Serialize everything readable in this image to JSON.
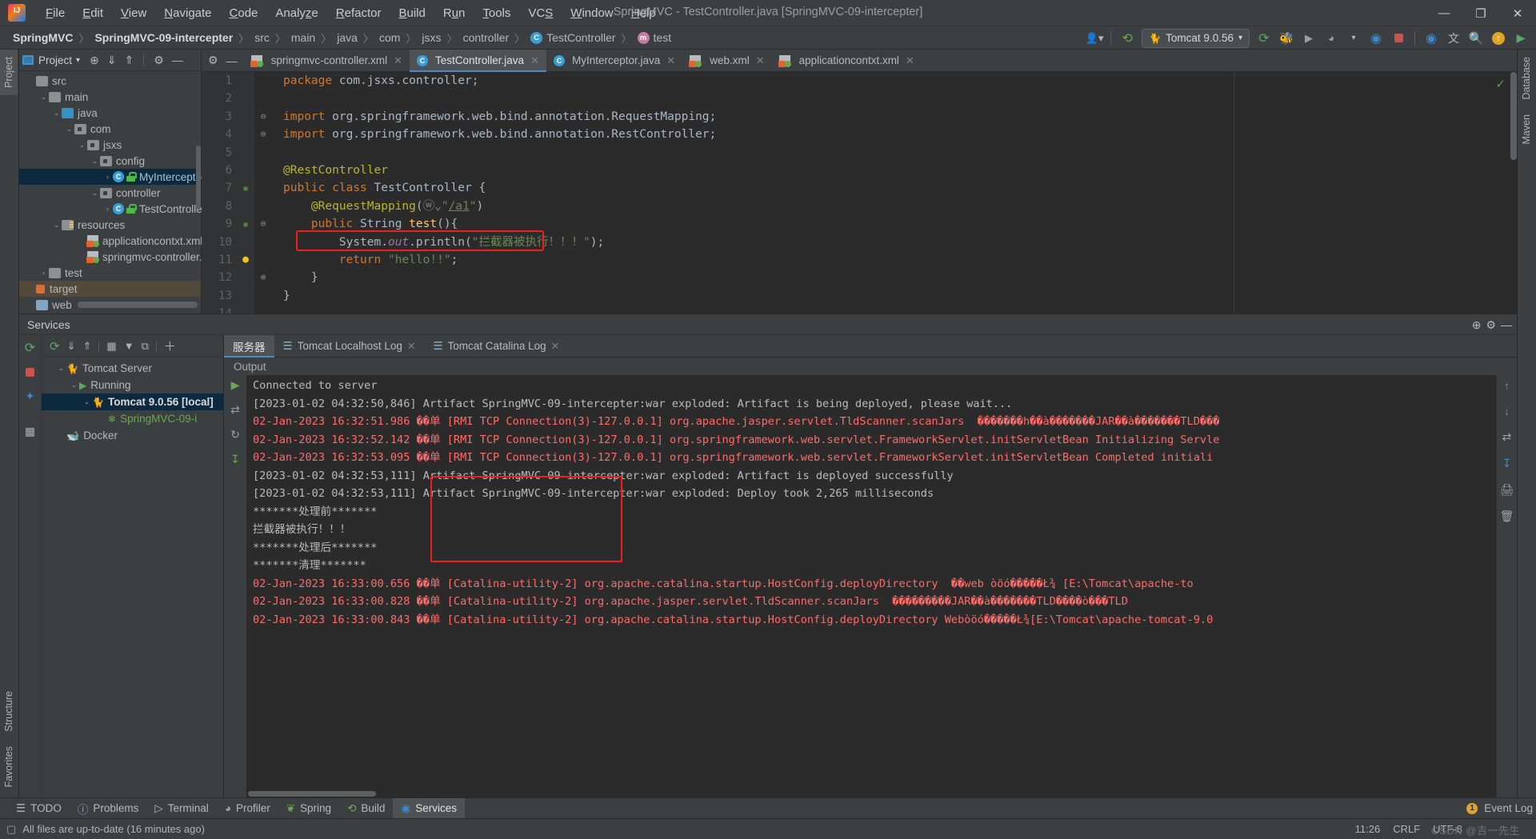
{
  "window": {
    "title": "SpringMVC - TestController.java [SpringMVC-09-intercepter]",
    "minimize": "—",
    "maximize": "❐",
    "close": "✕"
  },
  "menu": {
    "items": [
      {
        "label": "File"
      },
      {
        "label": "Edit"
      },
      {
        "label": "View"
      },
      {
        "label": "Navigate"
      },
      {
        "label": "Code"
      },
      {
        "label": "Analyze"
      },
      {
        "label": "Refactor"
      },
      {
        "label": "Build"
      },
      {
        "label": "Run"
      },
      {
        "label": "Tools"
      },
      {
        "label": "VCS"
      },
      {
        "label": "Window"
      },
      {
        "label": "Help"
      }
    ]
  },
  "breadcrumb": {
    "items": [
      {
        "label": "SpringMVC",
        "bold": true
      },
      {
        "label": "SpringMVC-09-intercepter",
        "bold": true
      },
      {
        "label": "src"
      },
      {
        "label": "main"
      },
      {
        "label": "java"
      },
      {
        "label": "com"
      },
      {
        "label": "jsxs"
      },
      {
        "label": "controller"
      },
      {
        "label": "TestController",
        "badge": "C"
      },
      {
        "label": "test",
        "badge": "m"
      }
    ],
    "separator": "〉"
  },
  "toolbar": {
    "run_config": "Tomcat 9.0.56",
    "icons": [
      {
        "name": "profile-dropdown-icon",
        "glyph": "👤"
      },
      {
        "name": "build-hammer-icon",
        "glyph": "🔨"
      },
      {
        "name": "run-icon",
        "glyph": "↻"
      },
      {
        "name": "debug-icon",
        "glyph": "🐞"
      },
      {
        "name": "run-coverage-icon",
        "glyph": "▶"
      },
      {
        "name": "profiler-icon",
        "glyph": "◔"
      },
      {
        "name": "dropdown-icon",
        "glyph": "▾"
      },
      {
        "name": "tomcat-run-icon",
        "glyph": "◎"
      },
      {
        "name": "stop-icon",
        "glyph": "■"
      },
      {
        "name": "tomcat-debug-icon",
        "glyph": "◎"
      },
      {
        "name": "translate-icon",
        "glyph": "文"
      },
      {
        "name": "search-everywhere-icon",
        "glyph": "🔍"
      },
      {
        "name": "update-icon",
        "glyph": "↑"
      },
      {
        "name": "plugin-icon",
        "glyph": "▶"
      }
    ]
  },
  "left_tool_strip": {
    "top": [
      {
        "label": "Project",
        "active": true
      }
    ],
    "bottom": [
      {
        "label": "Structure"
      },
      {
        "label": "Favorites"
      }
    ]
  },
  "right_tool_strip": {
    "top": [
      {
        "label": "Database"
      },
      {
        "label": "Maven"
      }
    ]
  },
  "project_panel": {
    "title": "Project",
    "header_icons": [
      {
        "name": "project-view-icon",
        "glyph": ""
      },
      {
        "name": "dropdown-icon",
        "glyph": "▾"
      },
      {
        "name": "locate-icon",
        "glyph": "⊕"
      },
      {
        "name": "expand-all-icon",
        "glyph": "⤓"
      },
      {
        "name": "collapse-all-icon",
        "glyph": "⤒"
      },
      {
        "name": "settings-gear-icon",
        "glyph": "⚙"
      },
      {
        "name": "hide-icon",
        "glyph": "—"
      }
    ],
    "tree": [
      {
        "label": "src",
        "depth": 0,
        "twist": "",
        "icon": "f-src"
      },
      {
        "label": "main",
        "depth": 1,
        "twist": "⌄",
        "icon": "f-grey"
      },
      {
        "label": "java",
        "depth": 2,
        "twist": "⌄",
        "icon": "f-blue"
      },
      {
        "label": "com",
        "depth": 3,
        "twist": "⌄",
        "icon": "f-pkg"
      },
      {
        "label": "jsxs",
        "depth": 4,
        "twist": "⌄",
        "icon": "f-pkg"
      },
      {
        "label": "config",
        "depth": 5,
        "twist": "⌄",
        "icon": "f-pkg"
      },
      {
        "label": "MyInterceptor",
        "depth": 6,
        "twist": "›",
        "icon": "class",
        "selected": true
      },
      {
        "label": "controller",
        "depth": 5,
        "twist": "⌄",
        "icon": "f-pkg"
      },
      {
        "label": "TestController",
        "depth": 6,
        "twist": "›",
        "icon": "class"
      },
      {
        "label": "resources",
        "depth": 2,
        "twist": "⌄",
        "icon": "f-res"
      },
      {
        "label": "applicationcontxt.xml",
        "depth": 3,
        "twist": "",
        "icon": "xml"
      },
      {
        "label": "springmvc-controller.xml",
        "depth": 3,
        "twist": "",
        "icon": "xml"
      },
      {
        "label": "test",
        "depth": 1,
        "twist": "›",
        "icon": "f-grey"
      },
      {
        "label": "target",
        "depth": 0,
        "twist": "",
        "icon": "target",
        "highlight": true
      },
      {
        "label": "web",
        "depth": 0,
        "twist": "",
        "icon": "web"
      }
    ]
  },
  "editor": {
    "tabs": [
      {
        "label": "springmvc-controller.xml",
        "icon": "xml",
        "active": false
      },
      {
        "label": "TestController.java",
        "icon": "class",
        "active": true
      },
      {
        "label": "MyInterceptor.java",
        "icon": "class",
        "active": false
      },
      {
        "label": "web.xml",
        "icon": "xml",
        "active": false
      },
      {
        "label": "applicationcontxt.xml",
        "icon": "xml",
        "active": false
      }
    ],
    "close_glyph": "✕",
    "lines": [
      {
        "num": "1",
        "gutter": "",
        "html": "<span class=\"kw\">package</span> com.jsxs.controller<span class=\"cls\">;</span>"
      },
      {
        "num": "2",
        "gutter": "",
        "html": ""
      },
      {
        "num": "3",
        "gutter": "",
        "fold": "⊖",
        "html": "<span class=\"kw\">import</span> org.springframework.web.bind.annotation.RequestMapping<span class=\"cls\">;</span>"
      },
      {
        "num": "4",
        "gutter": "",
        "fold": "⊖",
        "html": "<span class=\"kw\">import</span> org.springframework.web.bind.annotation.RestController<span class=\"cls\">;</span>"
      },
      {
        "num": "5",
        "gutter": "",
        "html": ""
      },
      {
        "num": "6",
        "gutter": "",
        "html": "<span class=\"anno\">@RestController</span>"
      },
      {
        "num": "7",
        "gutter": "spring",
        "html": "<span class=\"kw\">public class</span> <span class=\"cls\">TestController</span> {"
      },
      {
        "num": "8",
        "gutter": "",
        "html": "    <span class=\"anno\">@RequestMapping</span>(<span class=\"fold\">ⓦ⌄</span><span class=\"str\">\"</span><span class=\"link\">/a1</span><span class=\"str\">\"</span>)"
      },
      {
        "num": "9",
        "gutter": "spring",
        "fold": "⊖",
        "html": "    <span class=\"kw\">public</span> <span class=\"cls\">String</span> <span class=\"fn\">test</span>(){"
      },
      {
        "num": "10",
        "gutter": "",
        "html": "        <span class=\"cls\">System</span>.<span class=\"field\">out</span>.<span class=\"cls\">println</span>(<span class=\"str\">\"拦截器被执行！！！\"</span>)<span class=\"cls\">;</span>"
      },
      {
        "num": "11",
        "gutter": "bulb",
        "html": "        <span class=\"kw\">return</span> <span class=\"str\">\"hello!!\"</span><span class=\"cls\">;</span>"
      },
      {
        "num": "12",
        "gutter": "",
        "fold": "⊕",
        "html": "    }"
      },
      {
        "num": "13",
        "gutter": "",
        "html": "}"
      },
      {
        "num": "14",
        "gutter": "",
        "html": ""
      }
    ]
  },
  "services": {
    "title": "Services",
    "header_icons": [
      {
        "name": "services-settings-icon",
        "glyph": "⚙"
      },
      {
        "name": "help-icon",
        "glyph": "⊕"
      },
      {
        "name": "hide-panel-icon",
        "glyph": "—"
      }
    ],
    "side_icons": [
      {
        "name": "rerun-icon",
        "glyph": "↻"
      },
      {
        "name": "stop-icon",
        "glyph": "■"
      },
      {
        "name": "redeploy-icon",
        "glyph": "♦"
      },
      {
        "name": "filter-icon",
        "glyph": "▦"
      }
    ],
    "tree_toolbar": [
      {
        "name": "rerun-icon",
        "glyph": "↻"
      },
      {
        "name": "expand-all-icon",
        "glyph": "⤓"
      },
      {
        "name": "collapse-all-icon",
        "glyph": "⤒"
      },
      {
        "name": "group-icon",
        "glyph": "▦"
      },
      {
        "name": "filter-icon",
        "glyph": "▼"
      },
      {
        "name": "add-tab-icon",
        "glyph": "⧉"
      },
      {
        "name": "add-icon",
        "glyph": "＋"
      }
    ],
    "tree": [
      {
        "label": "Tomcat Server",
        "depth": 0,
        "twist": "⌄",
        "icon": "tomcat"
      },
      {
        "label": "Running",
        "depth": 1,
        "twist": "⌄",
        "icon": "run"
      },
      {
        "label": "Tomcat 9.0.56 [local]",
        "depth": 2,
        "twist": "⌄",
        "icon": "tomcat",
        "selected": true,
        "bold": true
      },
      {
        "label": "SpringMVC-09-i",
        "depth": 3,
        "twist": "",
        "icon": "artifact"
      },
      {
        "label": "Docker",
        "depth": 0,
        "twist": "",
        "icon": "docker"
      }
    ],
    "console_tabs": [
      {
        "label": "服务器",
        "active": true,
        "closable": false
      },
      {
        "label": "Tomcat Localhost Log",
        "active": false,
        "closable": true,
        "icon": "doc"
      },
      {
        "label": "Tomcat Catalina Log",
        "active": false,
        "closable": true,
        "icon": "doc"
      }
    ],
    "output_label": "Output",
    "gutter_icons": [
      {
        "name": "up-arrow-icon",
        "glyph": "↑"
      },
      {
        "name": "down-arrow-icon",
        "glyph": "↓"
      },
      {
        "name": "soft-wrap-icon",
        "glyph": "↩"
      },
      {
        "name": "scroll-end-icon",
        "glyph": "⤓"
      },
      {
        "name": "print-icon",
        "glyph": "🖨"
      },
      {
        "name": "clear-all-icon",
        "glyph": "🗑"
      }
    ],
    "left_gutter_icons": [
      {
        "name": "connect-icon",
        "glyph": "⇄"
      },
      {
        "name": "refresh-icon",
        "glyph": "↻"
      },
      {
        "name": "export-icon",
        "glyph": "⤓"
      }
    ],
    "console_lines": [
      {
        "text": "Connected to server",
        "color": "c-white"
      },
      {
        "text": "[2023-01-02 04:32:50,846] Artifact SpringMVC-09-intercepter:war exploded: Artifact is being deployed, please wait...",
        "color": "c-white"
      },
      {
        "text": "02-Jan-2023 16:32:51.986 ��单 [RMI TCP Connection(3)-127.0.0.1] org.apache.jasper.servlet.TldScanner.scanJars  �������h��à�������JAR��à�������TLD���",
        "color": "c-red"
      },
      {
        "text": "02-Jan-2023 16:32:52.142 ��单 [RMI TCP Connection(3)-127.0.0.1] org.springframework.web.servlet.FrameworkServlet.initServletBean Initializing Servle",
        "color": "c-red"
      },
      {
        "text": "02-Jan-2023 16:32:53.095 ��单 [RMI TCP Connection(3)-127.0.0.1] org.springframework.web.servlet.FrameworkServlet.initServletBean Completed initiali",
        "color": "c-red"
      },
      {
        "text": "[2023-01-02 04:32:53,111] Artifact SpringMVC-09-intercepter:war exploded: Artifact is deployed successfully",
        "color": "c-white"
      },
      {
        "text": "[2023-01-02 04:32:53,111] Artifact SpringMVC-09-intercepter:war exploded: Deploy took 2,265 milliseconds",
        "color": "c-white"
      },
      {
        "text": "*******处理前*******",
        "color": "c-white"
      },
      {
        "text": "拦截器被执行！！！",
        "color": "c-white"
      },
      {
        "text": "*******处理后*******",
        "color": "c-white"
      },
      {
        "text": "*******清理*******",
        "color": "c-white"
      },
      {
        "text": "02-Jan-2023 16:33:00.656 ��单 [Catalina-utility-2] org.apache.catalina.startup.HostConfig.deployDirectory  ��web òöó�����Ł¾ [E:\\Tomcat\\apache-to",
        "color": "c-red"
      },
      {
        "text": "02-Jan-2023 16:33:00.828 ��单 [Catalina-utility-2] org.apache.jasper.servlet.TldScanner.scanJars  ���������JAR��à�������TLD����ò���TLD",
        "color": "c-red"
      },
      {
        "text": "02-Jan-2023 16:33:00.843 ��单 [Catalina-utility-2] org.apache.catalina.startup.HostConfig.deployDirectory Webòöó�����Ł¾[E:\\Tomcat\\apache-tomcat-9.0",
        "color": "c-red"
      }
    ]
  },
  "bottom_bar": {
    "items": [
      {
        "label": "TODO",
        "icon": "☰",
        "active": false
      },
      {
        "label": "Problems",
        "icon": "ⓘ",
        "active": false
      },
      {
        "label": "Terminal",
        "icon": "▷",
        "active": false
      },
      {
        "label": "Profiler",
        "icon": "◔",
        "active": false
      },
      {
        "label": "Spring",
        "icon": "❦",
        "active": false
      },
      {
        "label": "Build",
        "icon": "🔨",
        "active": false
      },
      {
        "label": "Services",
        "icon": "⚙",
        "active": true
      }
    ],
    "event_log": "Event Log",
    "event_count": "1"
  },
  "status_bar": {
    "message": "All files are up-to-date (16 minutes ago)",
    "caret": "11:26",
    "line_separator": "CRLF",
    "encoding": "UTF-8",
    "watermark": "CSDN @吉一先生"
  },
  "colors": {
    "accent": "#4a88c7",
    "highlight_box": "#f21d1d",
    "selection": "#0d293e",
    "error_text": "#ff6b68",
    "keyword": "#cc7832",
    "string": "#6a8759",
    "annotation": "#bbb529"
  }
}
